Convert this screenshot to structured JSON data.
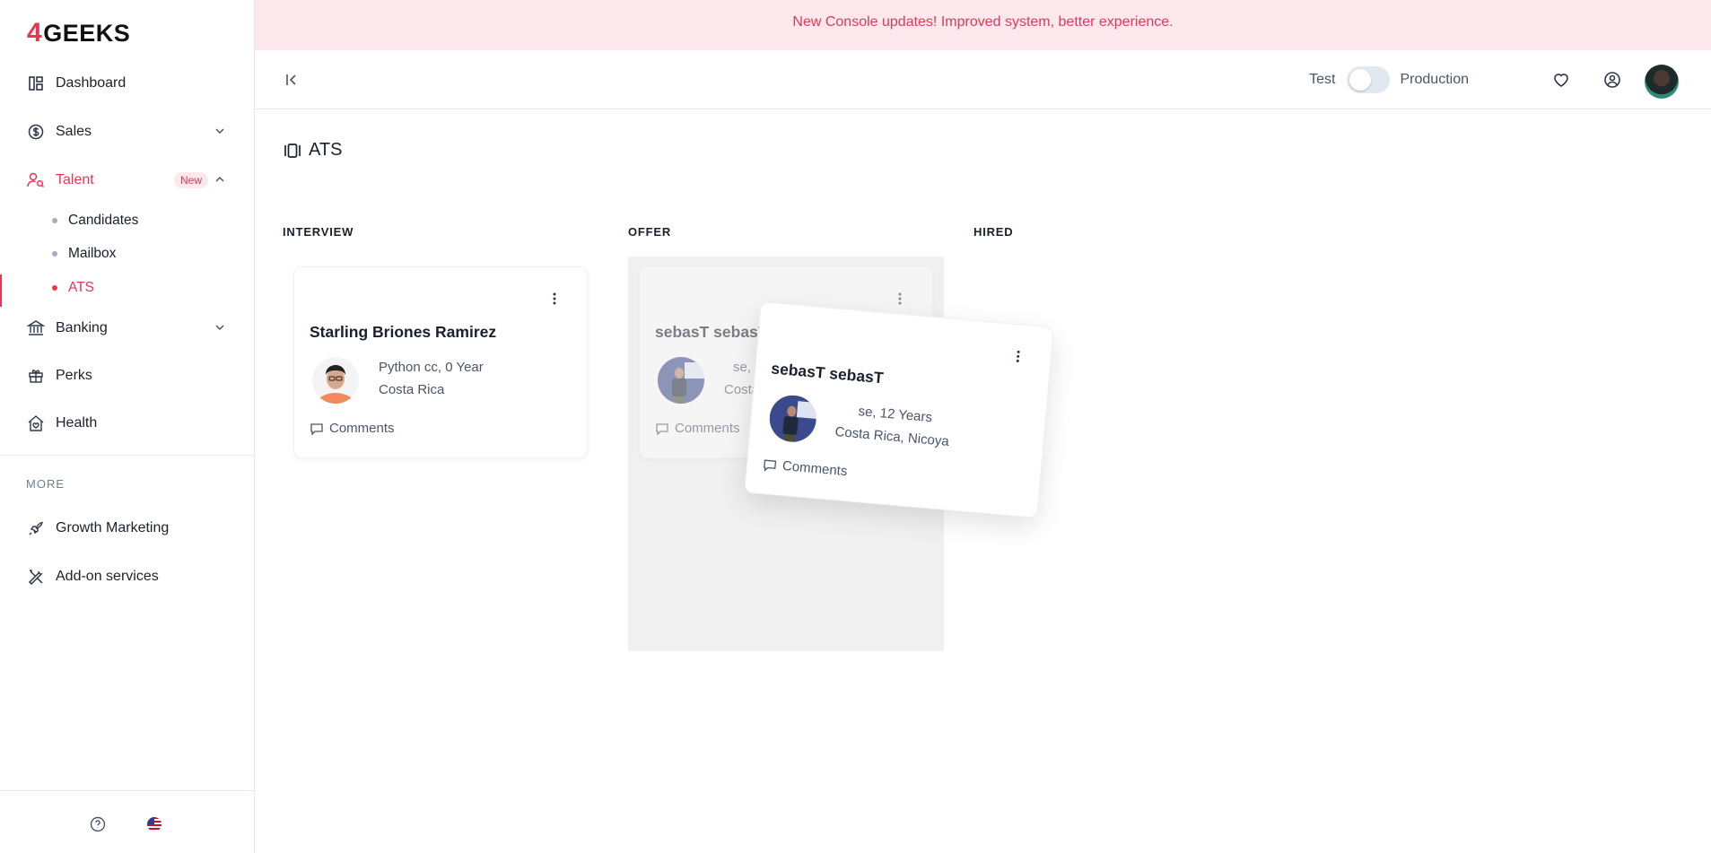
{
  "brand": {
    "logo_num": "4",
    "logo_text": "GEEKS",
    "accent": "#e8364f"
  },
  "banner": {
    "text": "New Console updates! Improved system, better experience."
  },
  "sidebar": {
    "items": [
      {
        "label": "Dashboard",
        "icon": "dashboard-icon"
      },
      {
        "label": "Sales",
        "icon": "dollar-icon"
      },
      {
        "label": "Talent",
        "icon": "user-search-icon",
        "badge": "New"
      },
      {
        "label": "Banking",
        "icon": "bank-icon"
      },
      {
        "label": "Perks",
        "icon": "gift-icon"
      },
      {
        "label": "Health",
        "icon": "house-heart-icon"
      }
    ],
    "talent_sub": [
      {
        "label": "Candidates"
      },
      {
        "label": "Mailbox"
      },
      {
        "label": "ATS"
      }
    ],
    "more_label": "MORE",
    "more_items": [
      {
        "label": "Growth Marketing",
        "icon": "rocket-icon"
      },
      {
        "label": "Add-on services",
        "icon": "tools-icon"
      }
    ]
  },
  "topbar": {
    "env_test": "Test",
    "env_production": "Production"
  },
  "page": {
    "title": "ATS"
  },
  "columns": [
    {
      "title": "INTERVIEW"
    },
    {
      "title": "OFFER"
    },
    {
      "title": "HIRED"
    }
  ],
  "cards": {
    "interview_1": {
      "name": "Starling Briones Ramirez",
      "role": "Python cc, 0 Year",
      "location": "Costa Rica",
      "comments": "Comments"
    },
    "offer_ghost": {
      "name": "sebasT sebasT",
      "role": "se,",
      "location": "Costa",
      "comments": "Comments"
    },
    "offer_drag": {
      "name": "sebasT sebasT",
      "role": "se, 12 Years",
      "location": "Costa Rica, Nicoya",
      "comments": "Comments"
    }
  }
}
